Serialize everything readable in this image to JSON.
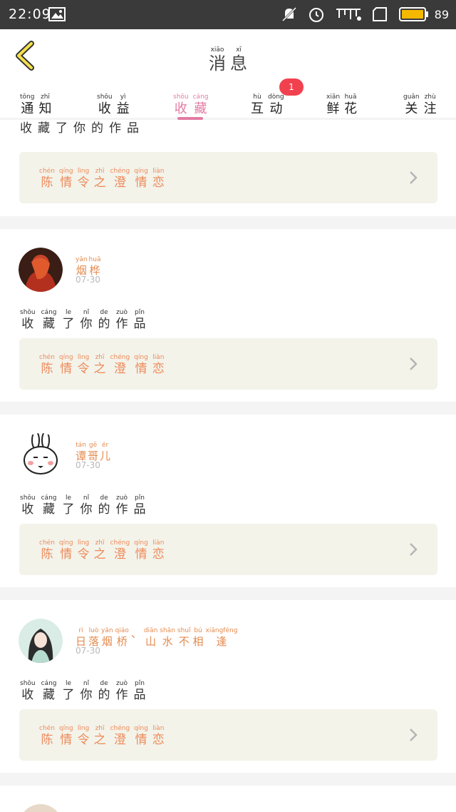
{
  "status_bar": {
    "time": "22:09",
    "battery": "89"
  },
  "header": {
    "title": [
      {
        "py": "xiāo",
        "hz": "消"
      },
      {
        "py": "xī",
        "hz": "息"
      }
    ]
  },
  "tabs": [
    {
      "name": "notice",
      "chars": [
        {
          "py": "tōng",
          "hz": "通"
        },
        {
          "py": "zhī",
          "hz": "知"
        }
      ]
    },
    {
      "name": "income",
      "chars": [
        {
          "py": "shōu",
          "hz": "收"
        },
        {
          "py": "yì",
          "hz": "益"
        }
      ]
    },
    {
      "name": "favorite",
      "chars": [
        {
          "py": "shōu",
          "hz": "收"
        },
        {
          "py": "cáng",
          "hz": "藏"
        }
      ]
    },
    {
      "name": "interact",
      "chars": [
        {
          "py": "hù",
          "hz": "互"
        },
        {
          "py": "dòng",
          "hz": "动"
        }
      ]
    },
    {
      "name": "flowers",
      "chars": [
        {
          "py": "xiān",
          "hz": "鲜"
        },
        {
          "py": "huā",
          "hz": "花"
        }
      ]
    },
    {
      "name": "follow",
      "chars": [
        {
          "py": "guān",
          "hz": "关"
        },
        {
          "py": "zhù",
          "hz": "注"
        }
      ]
    }
  ],
  "interact_badge": "1",
  "accent_color": "#e27ba3",
  "action_text": [
    {
      "py": "shōu",
      "hz": "收"
    },
    {
      "py": "cáng",
      "hz": "藏"
    },
    {
      "py": "le",
      "hz": "了"
    },
    {
      "py": "nǐ",
      "hz": "你"
    },
    {
      "py": "de",
      "hz": "的"
    },
    {
      "py": "zuò",
      "hz": "作"
    },
    {
      "py": "pǐn",
      "hz": "品"
    }
  ],
  "work_title": [
    {
      "py": "chén",
      "hz": "陈"
    },
    {
      "py": "qíng",
      "hz": "情"
    },
    {
      "py": "lìng",
      "hz": "令"
    },
    {
      "py": "zhī",
      "hz": "之"
    },
    {
      "py": "chéng",
      "hz": "澄"
    },
    {
      "py": "qíng",
      "hz": "情"
    },
    {
      "py": "liàn",
      "hz": "恋"
    }
  ],
  "cards": [
    {
      "avatar": "red-robed-avatar",
      "user": [],
      "date": ""
    },
    {
      "avatar": "red-robed-avatar",
      "user": [
        {
          "py": "yān",
          "hz": "烟"
        },
        {
          "py": "huā",
          "hz": "桦"
        }
      ],
      "date": "07-30"
    },
    {
      "avatar": "bunny-avatar",
      "user": [
        {
          "py": "tán",
          "hz": "谭"
        },
        {
          "py": "gē",
          "hz": "哥"
        },
        {
          "py": "ér",
          "hz": "儿"
        }
      ],
      "date": "07-30"
    },
    {
      "avatar": "girl-avatar",
      "user": [
        {
          "py": "rì",
          "hz": "日"
        },
        {
          "py": "luò",
          "hz": "落"
        },
        {
          "py": "yān",
          "hz": "烟"
        },
        {
          "py": "qiáo",
          "hz": "桥"
        },
        {
          "py": "",
          "hz": "、"
        },
        {
          "py": "diān",
          "hz": "山"
        },
        {
          "py": "shān",
          "hz": "水"
        },
        {
          "py": "shuǐ",
          "hz": "不"
        },
        {
          "py": "bú",
          "hz": "相"
        },
        {
          "py": "xiāngféng",
          "hz": "逢"
        }
      ],
      "date": "07-30"
    }
  ]
}
